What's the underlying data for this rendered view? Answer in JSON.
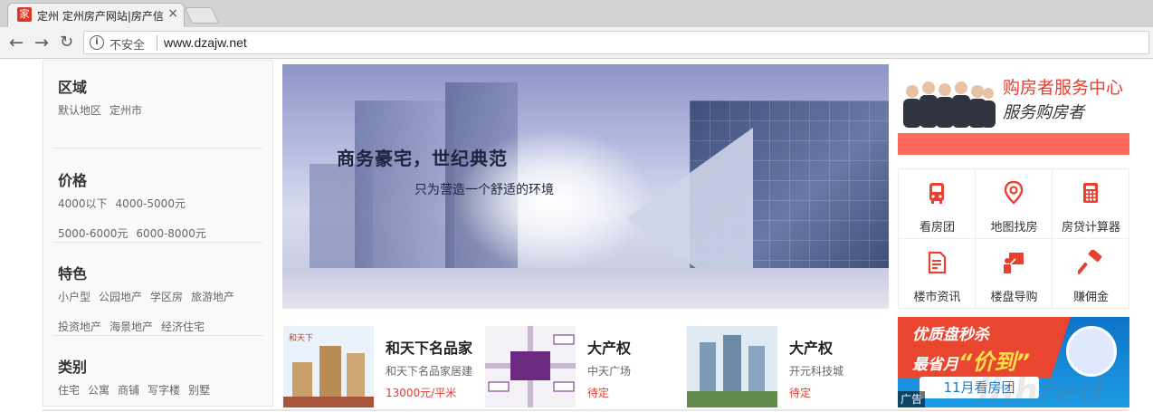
{
  "browser": {
    "tab_title": "定州 定州房产网站|房产信",
    "favicon_text": "家",
    "security_label": "不安全",
    "url": "www.dzajw.net"
  },
  "nav": {
    "region": {
      "title": "区域",
      "rows": [
        [
          "默认地区",
          "定州市"
        ]
      ]
    },
    "price": {
      "title": "价格",
      "rows": [
        [
          "4000以下",
          "4000-5000元"
        ],
        [
          "5000-6000元",
          "6000-8000元"
        ]
      ]
    },
    "feature": {
      "title": "特色",
      "rows": [
        [
          "小户型",
          "公园地产",
          "学区房",
          "旅游地产"
        ],
        [
          "投资地产",
          "海景地产",
          "经济住宅"
        ]
      ]
    },
    "category": {
      "title": "类别",
      "rows": [
        [
          "住宅",
          "公寓",
          "商铺",
          "写字楼",
          "别墅"
        ]
      ]
    }
  },
  "banner": {
    "headline": "商务豪宅，世纪典范",
    "subline": "只为营造一个舒适的环境"
  },
  "listings": [
    {
      "name": "和天下名品家",
      "sub": "和天下名品家居建",
      "price": "13000元/平米"
    },
    {
      "name": "大产权",
      "sub": "中天广场",
      "price": "待定"
    },
    {
      "name": "大产权",
      "sub": "开元科技城",
      "price": "待定"
    }
  ],
  "service": {
    "title": "购房者服务中心",
    "subtitle": "服务购房者"
  },
  "quick_links": [
    {
      "label": "看房团",
      "icon": "bus-icon"
    },
    {
      "label": "地图找房",
      "icon": "map-pin-icon"
    },
    {
      "label": "房贷计算器",
      "icon": "calculator-icon"
    },
    {
      "label": "楼市资讯",
      "icon": "document-icon"
    },
    {
      "label": "楼盘导购",
      "icon": "presentation-icon"
    },
    {
      "label": "赚佣金",
      "icon": "hammer-icon"
    }
  ],
  "ad": {
    "line1": "优质盘秒杀",
    "line2_prefix": "最省月",
    "line2_highlight": "“价到”",
    "button": "11月看房团",
    "badge": "广告"
  },
  "colors": {
    "accent": "#e8402f",
    "red_bar": "#ff6a5a",
    "price": "#e23b2f"
  }
}
